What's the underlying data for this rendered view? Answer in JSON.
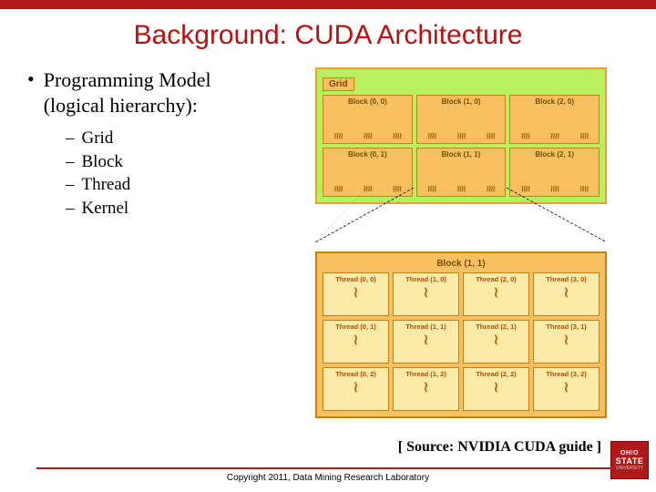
{
  "title": "Background: CUDA Architecture",
  "bullet": {
    "line1": "Programming Model",
    "line2": "(logical hierarchy):"
  },
  "subitems": [
    "Grid",
    "Block",
    "Thread",
    "Kernel"
  ],
  "diagram": {
    "grid_label": "Grid",
    "blocks": [
      [
        "Block (0, 0)",
        "Block (1, 0)",
        "Block (2, 0)"
      ],
      [
        "Block (0, 1)",
        "Block (1, 1)",
        "Block (2, 1)"
      ]
    ],
    "block_detail_label": "Block (1, 1)",
    "threads": [
      [
        "Thread (0, 0)",
        "Thread (1, 0)",
        "Thread (2, 0)",
        "Thread (3, 0)"
      ],
      [
        "Thread (0, 1)",
        "Thread (1, 1)",
        "Thread (2, 1)",
        "Thread (3, 1)"
      ],
      [
        "Thread (0, 2)",
        "Thread (1, 2)",
        "Thread (2, 2)",
        "Thread (3, 2)"
      ]
    ]
  },
  "source": "[ Source: NVIDIA CUDA guide ]",
  "copyright": "Copyright 2011, Data Mining Research Laboratory",
  "logo": {
    "l1": "OHIO",
    "l2": "STATE",
    "l3": "UNIVERSITY"
  }
}
